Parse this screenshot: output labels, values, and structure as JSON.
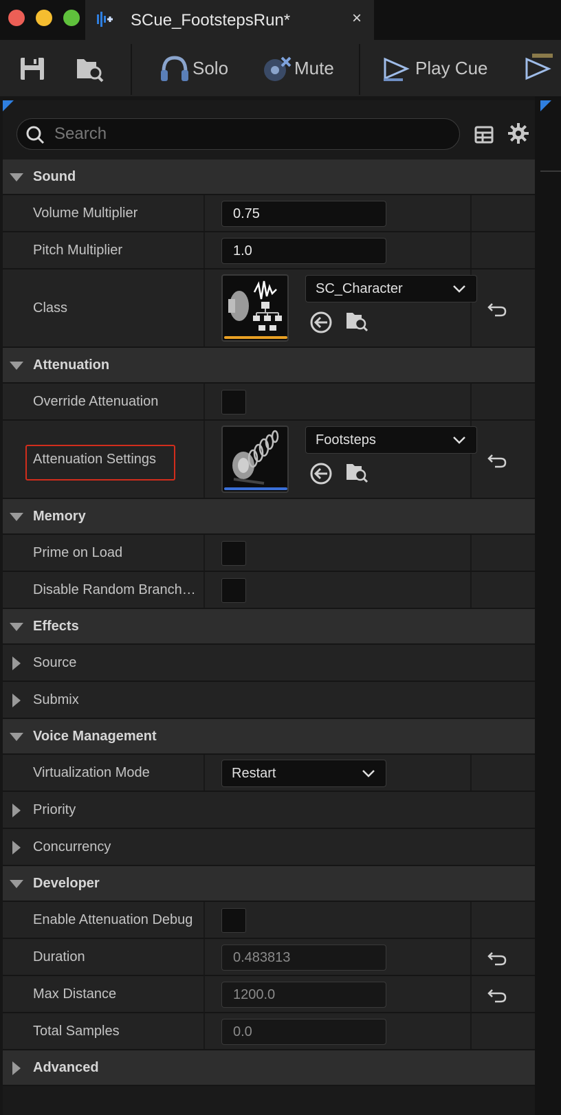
{
  "window": {
    "tab_title": "SCue_FootstepsRun*",
    "close_glyph": "×"
  },
  "toolbar": {
    "solo_label": "Solo",
    "mute_label": "Mute",
    "play_cue_label": "Play Cue",
    "icons": [
      "save-icon",
      "browse-asset-icon",
      "solo-icon",
      "mute-icon",
      "play-cue-icon",
      "play-node-icon"
    ]
  },
  "search": {
    "placeholder": "Search"
  },
  "sections": {
    "sound": {
      "title": "Sound",
      "volume_label": "Volume Multiplier",
      "volume_value": "0.75",
      "pitch_label": "Pitch Multiplier",
      "pitch_value": "1.0",
      "class_label": "Class",
      "class_value": "SC_Character",
      "class_thumb_color": "#e8a024"
    },
    "attenuation": {
      "title": "Attenuation",
      "override_label": "Override Attenuation",
      "override_checked": false,
      "settings_label": "Attenuation Settings",
      "settings_value": "Footsteps",
      "settings_thumb_color": "#3a6fd8",
      "highlight_color": "#d22d1c"
    },
    "memory": {
      "title": "Memory",
      "prime_label": "Prime on Load",
      "prime_checked": false,
      "disable_random_label": "Disable Random Branch…",
      "disable_random_checked": false
    },
    "effects": {
      "title": "Effects",
      "source_label": "Source",
      "submix_label": "Submix"
    },
    "voice": {
      "title": "Voice Management",
      "virtualization_label": "Virtualization Mode",
      "virtualization_value": "Restart",
      "priority_label": "Priority",
      "concurrency_label": "Concurrency"
    },
    "developer": {
      "title": "Developer",
      "debug_label": "Enable Attenuation Debug",
      "debug_checked": false,
      "duration_label": "Duration",
      "duration_value": "0.483813",
      "max_distance_label": "Max Distance",
      "max_distance_value": "1200.0",
      "total_samples_label": "Total Samples",
      "total_samples_value": "0.0"
    },
    "advanced": {
      "title": "Advanced"
    }
  },
  "colors": {
    "accent_blue": "#2f7fe0",
    "background": "#1a1a1a",
    "row_bg": "#232323",
    "category_bg": "#2e2e2e"
  }
}
